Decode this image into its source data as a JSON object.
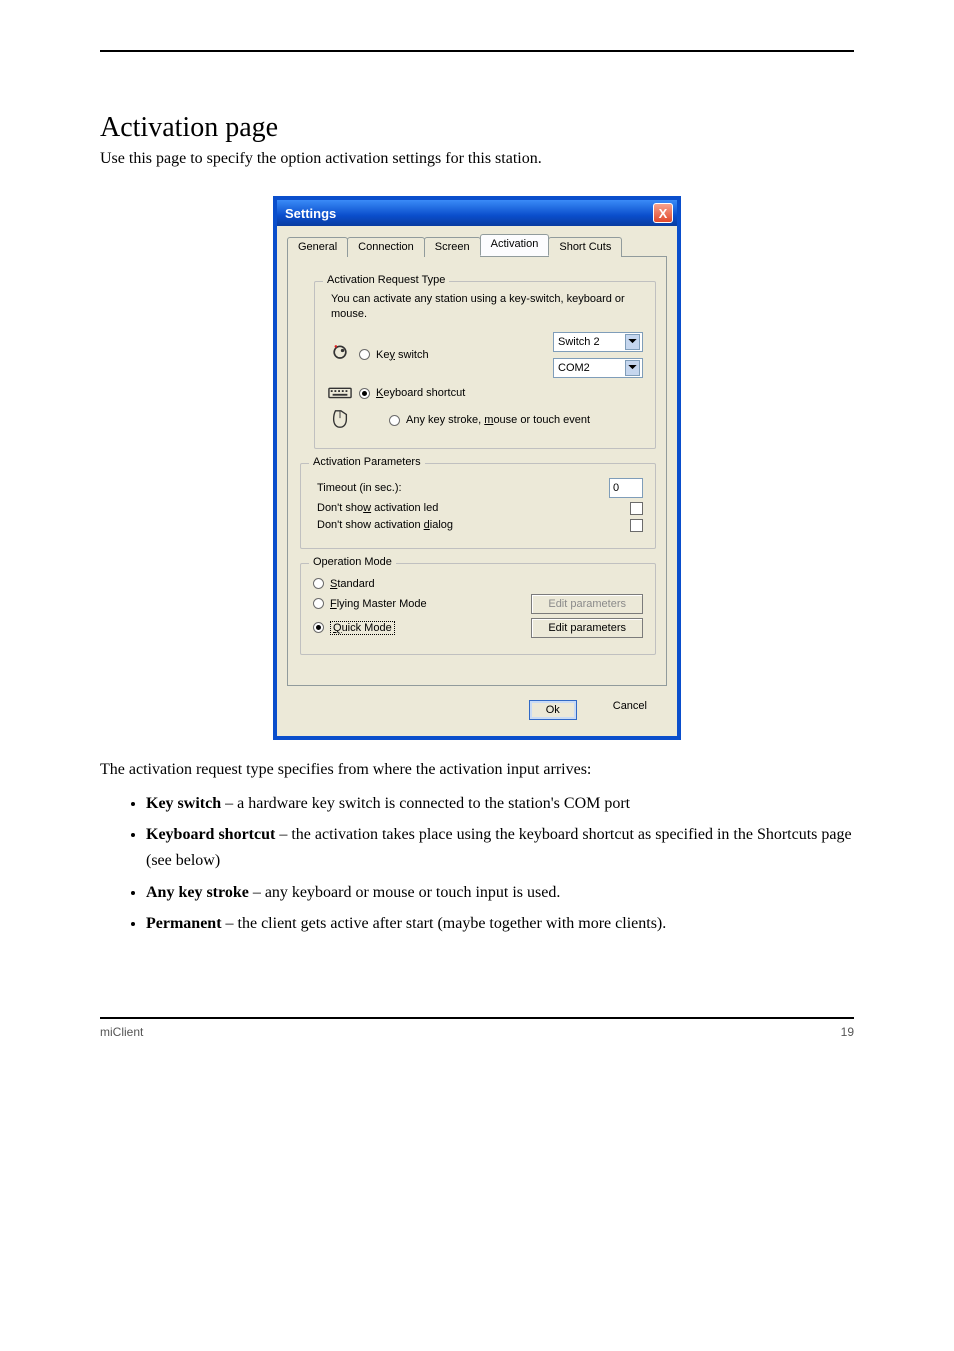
{
  "header": {
    "separator": true
  },
  "section": {
    "title": "Activation page",
    "subtitle": "Use this page to specify the option activation settings for this station."
  },
  "dialog": {
    "title": "Settings",
    "close_glyph": "X",
    "tabs": {
      "general": "General",
      "connection": "Connection",
      "screen": "Screen",
      "activation": "Activation",
      "shortcuts": "Short Cuts"
    },
    "activation_request": {
      "legend": "Activation Request Type",
      "hint": "You can activate any station using a key-switch, keyboard or mouse.",
      "options": {
        "key_switch": {
          "pre": "Ke",
          "ul": "y",
          "post": " switch",
          "selected": false
        },
        "keyboard_shortcut": {
          "ul": "K",
          "post": "eyboard shortcut",
          "selected": true
        },
        "any_key": {
          "pre": "Any key stroke, ",
          "ul": "m",
          "post": "ouse or touch event",
          "selected": false
        }
      },
      "dropdowns": {
        "switch_value": "Switch 2",
        "com_value": "COM2"
      }
    },
    "activation_params": {
      "legend": "Activation Parameters",
      "timeout_label": "Timeout (in sec.):",
      "timeout_value": "0",
      "dont_show_led": {
        "pre": "Don't sho",
        "ul": "w",
        "post": " activation led",
        "checked": false
      },
      "dont_show_dialog": {
        "pre": "Don't show activation ",
        "ul": "d",
        "post": "ialog",
        "checked": false
      }
    },
    "operation_mode": {
      "legend": "Operation Mode",
      "standard": {
        "ul": "S",
        "post": "tandard",
        "selected": false
      },
      "flying": {
        "ul": "F",
        "post": "lying Master Mode",
        "selected": false
      },
      "quick": {
        "ul": "Q",
        "post": "uick Mode",
        "selected": true
      },
      "edit_flying_btn": {
        "ul": "E",
        "post": "dit parameters"
      },
      "edit_quick_btn": {
        "pre": "Edi",
        "ul": "t",
        "post": " parameters"
      }
    },
    "buttons": {
      "ok": "Ok",
      "cancel": "Cancel"
    }
  },
  "body_text": "The activation request type specifies from where the activation input arrives:",
  "bullets": [
    {
      "label": "Key switch",
      "desc": " – a hardware key switch is connected to the station's COM port"
    },
    {
      "label": "Keyboard shortcut",
      "desc": " – the activation takes place using the keyboard shortcut as specified in the Shortcuts page (see below)"
    },
    {
      "label": "Any key stroke",
      "desc": " – any keyboard or mouse or touch input is used."
    },
    {
      "label": "Permanent",
      "desc": " – the client gets active after start (maybe together with more clients)."
    }
  ],
  "footer": {
    "left": "miClient",
    "right": "19"
  }
}
